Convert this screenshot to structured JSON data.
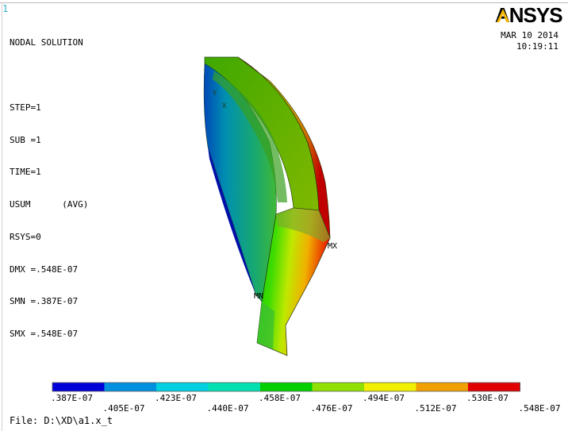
{
  "window_index": "1",
  "solution_info": {
    "title": "NODAL SOLUTION",
    "step": "STEP=1",
    "sub": "SUB =1",
    "time": "TIME=1",
    "usum": "USUM      (AVG)",
    "rsys": "RSYS=0",
    "dmx": "DMX =.548E-07",
    "smn": "SMN =.387E-07",
    "smx": "SMX =.548E-07"
  },
  "logo_text": "ANSYS",
  "timestamp": {
    "date": "MAR 10 2014",
    "time": "10:19:11"
  },
  "model_labels": {
    "max": "MX",
    "min": "MN",
    "axis_x": "X",
    "axis_y": "Y"
  },
  "legend": {
    "colors": [
      "#0000d8",
      "#0090e0",
      "#00d0e0",
      "#00e0b0",
      "#00d000",
      "#90e000",
      "#f0f000",
      "#f0a000",
      "#e00000"
    ],
    "top_labels": [
      ".387E-07",
      ".423E-07",
      ".458E-07",
      ".494E-07",
      ".530E-07"
    ],
    "bottom_labels": [
      ".405E-07",
      ".440E-07",
      ".476E-07",
      ".512E-07",
      ".548E-07"
    ]
  },
  "file_label": "File: D:\\XD\\a1.x_t"
}
